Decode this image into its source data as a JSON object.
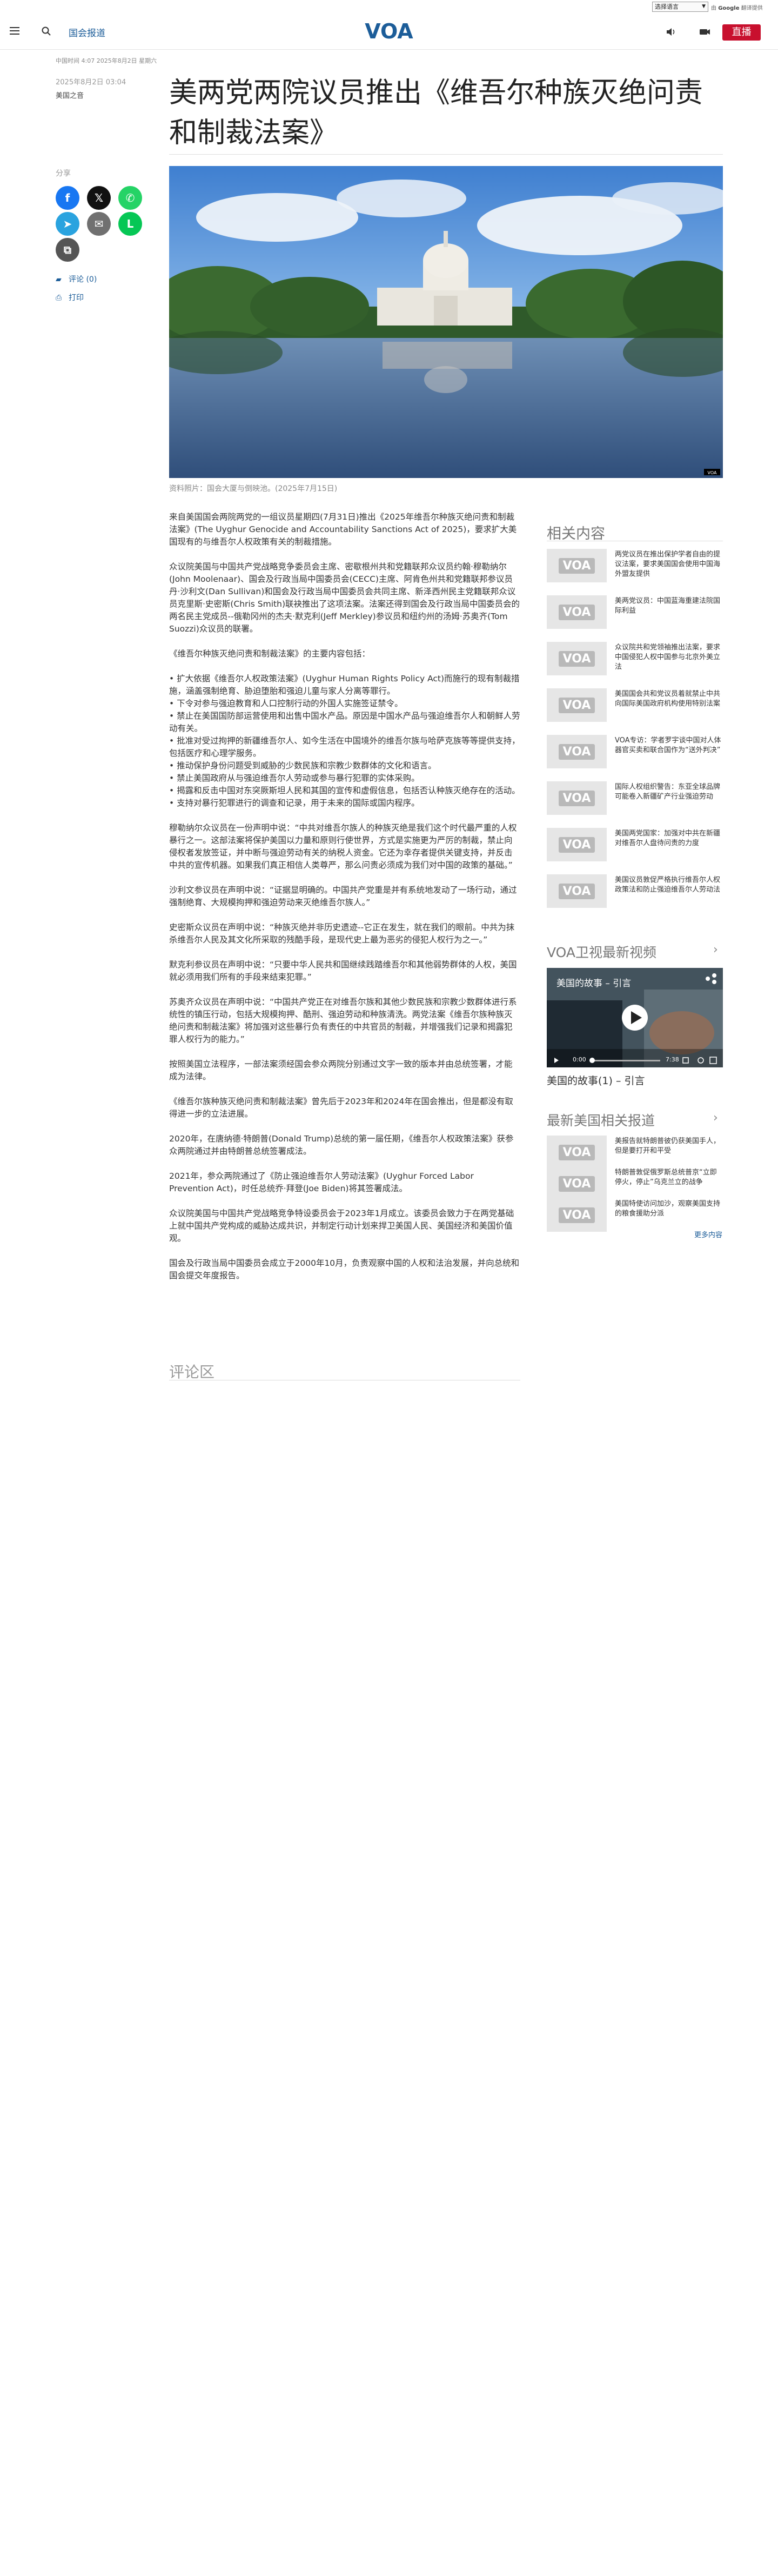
{
  "utility": {
    "language_select": "选择语言",
    "powered_prefix": "由",
    "powered_brand": "Google",
    "powered_suffix": "翻译提供"
  },
  "header": {
    "section": "国会报道",
    "logo_text": "VOA",
    "live_label": "直播",
    "icons": [
      "menu-icon",
      "search-icon",
      "audio-icon",
      "video-icon"
    ],
    "colors": {
      "brand": "#1c5d99",
      "live": "#c8102e"
    }
  },
  "note": "中国时间 4:07 2025年8月2日 星期六",
  "article": {
    "date": "2025年8月2日 03:04",
    "byline": "美国之音",
    "title": "美两党两院议员推出《维吾尔种族灭绝问责和制裁法案》",
    "caption": "资料照片：国会大厦与倒映池。(2025年7月15日)",
    "paragraphs": [
      "来自美国国会两院两党的一组议员星期四(7月31日)推出《2025年维吾尔种族灭绝问责和制裁法案》(The Uyghur Genocide and Accountability Sanctions Act of 2025)，要求扩大美国现有的与维吾尔人权政策有关的制裁措施。",
      "众议院美国与中国共产党战略竞争委员会主席、密歇根州共和党籍联邦众议员约翰·穆勒纳尔(John Moolenaar)、国会及行政当局中国委员会(CECC)主席、阿肯色州共和党籍联邦参议员丹·沙利文(Dan Sullivan)和国会及行政当局中国委员会共同主席、新泽西州民主党籍联邦众议员克里斯·史密斯(Chris Smith)联袂推出了这项法案。法案还得到国会及行政当局中国委员会的两名民主党成员--俄勒冈州的杰夫·默克利(Jeff Merkley)参议员和纽约州的汤姆·苏奥齐(Tom Suozzi)众议员的联署。",
      "《维吾尔种族灭绝问责和制裁法案》的主要内容包括：",
      "• 扩大依据《维吾尔人权政策法案》(Uyghur Human Rights Policy Act)而施行的现有制裁措施，涵盖强制绝育、胁迫堕胎和强迫儿童与家人分离等罪行。\n• 下令对参与强迫教育和人口控制行动的外国人实施签证禁令。\n• 禁止在美国国防部运营使用和出售中国水产品。原因是中国水产品与强迫维吾尔人和朝鲜人劳动有关。\n• 批准对受过拘押的新疆维吾尔人、如今生活在中国境外的维吾尔族与哈萨克族等等提供支持，包括医疗和心理学服务。\n• 推动保护身份问题受到威胁的少数民族和宗教少数群体的文化和语言。\n• 禁止美国政府从与强迫维吾尔人劳动或参与暴行犯罪的实体采购。\n• 揭露和反击中国对东突厥斯坦人民和其国的宣传和虚假信息，包括否认种族灭绝存在的活动。\n• 支持对暴行犯罪进行的调查和记录，用于未来的国际或国内程序。",
      "穆勒纳尔众议员在一份声明中说：“中共对维吾尔族人的种族灭绝是我们这个时代最严重的人权暴行之一。这部法案将保护美国以力量和原则行使世界，方式是实施更为严厉的制裁，禁止向侵权者发放签证，并中断与强迫劳动有关的纳税人资金。它还为幸存者提供关键支持，并反击中共的宣传机器。如果我们真正相信人类尊严，那么问责必须成为我们对中国的政策的基础。”",
      "沙利文参议员在声明中说：“证据显明确的。中国共产党重是并有系统地发动了一场行动，通过强制绝育、大规模拘押和强迫劳动来灭绝维吾尔族人。”",
      "史密斯众议员在声明中说：“种族灭绝并非历史遗迹--它正在发生，就在我们的眼前。中共为抹杀维吾尔人民及其文化所采取的残酷手段，是现代史上最为恶劣的侵犯人权行为之一。”",
      "默克利参议员在声明中说：“只要中华人民共和国继续践踏维吾尔和其他弱势群体的人权，美国就必须用我们所有的手段来结束犯罪。”",
      "苏奥齐众议员在声明中说：“中国共产党正在对维吾尔族和其他少数民族和宗教少数群体进行系统性的镇压行动，包括大规模拘押、酷刑、强迫劳动和种族清洗。两党法案《维吾尔族种族灭绝问责和制裁法案》将加强对这些暴行负有责任的中共官员的制裁，并增强我们记录和揭露犯罪人权行为的能力。”",
      "按照美国立法程序，一部法案须经国会参众两院分别通过文字一致的版本并由总统签署，才能成为法律。",
      "《维吾尔族种族灭绝问责和制裁法案》曾先后于2023年和2024年在国会推出，但是都没有取得进一步的立法进展。",
      "2020年，在唐纳德·特朗普(Donald Trump)总统的第一届任期，《维吾尔人权政策法案》获参众两院通过并由特朗普总统签署成法。",
      "2021年，参众两院通过了《防止强迫维吾尔人劳动法案》(Uyghur Forced Labor Prevention Act)，时任总统乔·拜登(Joe Biden)将其签署成法。",
      "众议院美国与中国共产党战略竞争特设委员会于2023年1月成立。该委员会致力于在两党基础上就中国共产党构成的威胁达成共识，并制定行动计划来捍卫美国人民、美国经济和美国价值观。",
      "国会及行政当局中国委员会成立于2000年10月，负责观察中国的人权和法治发展，并向总统和国会提交年度报告。"
    ]
  },
  "share": {
    "label": "分享",
    "buttons": [
      {
        "name": "facebook-share-button",
        "glyph": "f",
        "color": "#1877f2"
      },
      {
        "name": "x-share-button",
        "glyph": "𝕏",
        "color": "#111111"
      },
      {
        "name": "whatsapp-share-button",
        "glyph": "✆",
        "color": "#25d366"
      },
      {
        "name": "telegram-share-button",
        "glyph": "➤",
        "color": "#2aa3df"
      },
      {
        "name": "email-share-button",
        "glyph": "✉",
        "color": "#707070"
      },
      {
        "name": "line-share-button",
        "glyph": "L",
        "color": "#06c755"
      },
      {
        "name": "copy-link-button",
        "glyph": "⧉",
        "color": "#555555"
      }
    ],
    "comments_link": "评论 (0)",
    "print_link": "打印"
  },
  "sidebar": {
    "related_heading": "相关内容",
    "related": [
      "两党议员在推出保护学者自由的提议法案，要求美国国会使用中国海外盟友提供",
      "美两党议员：中国蓝海重建法院国际利益",
      "众议院共和党领袖推出法案，要求中国侵犯人权中国参与北京外美立法",
      "美国国会共和党议员着就禁止中共向国际美国政府机构使用特别法案",
      "VOA专访：学者罗宇谈中国对人体器官买卖和联合国作为“送外判决”",
      "国际人权组织警告：东亚全球品牌可能卷入新疆矿产行业强迫劳动",
      "美国两党国家：加强对中共在新疆对维吾尔人盘待问责的力度",
      "美国议员敦促严格执行维吾尔人权政策法和防止强迫维吾尔人劳动法"
    ],
    "video_heading": "VOA卫视最新视频",
    "video_title": "美国的故事 – 引言",
    "video_time": "0:00",
    "video_duration": "7:38",
    "video_caption": "美国的故事(1) – 引言",
    "latest_heading": "最新美国相关报道",
    "latest": [
      "美报告就特朗普彼仍获美国手人，但是要打开和平受",
      "特朗普敦促俄罗斯总统普京“立即停火，停止”乌克兰立的战争",
      "美国特使访问加沙，观察美国支持的粮食援助分派"
    ],
    "more_link": "更多内容"
  }
}
